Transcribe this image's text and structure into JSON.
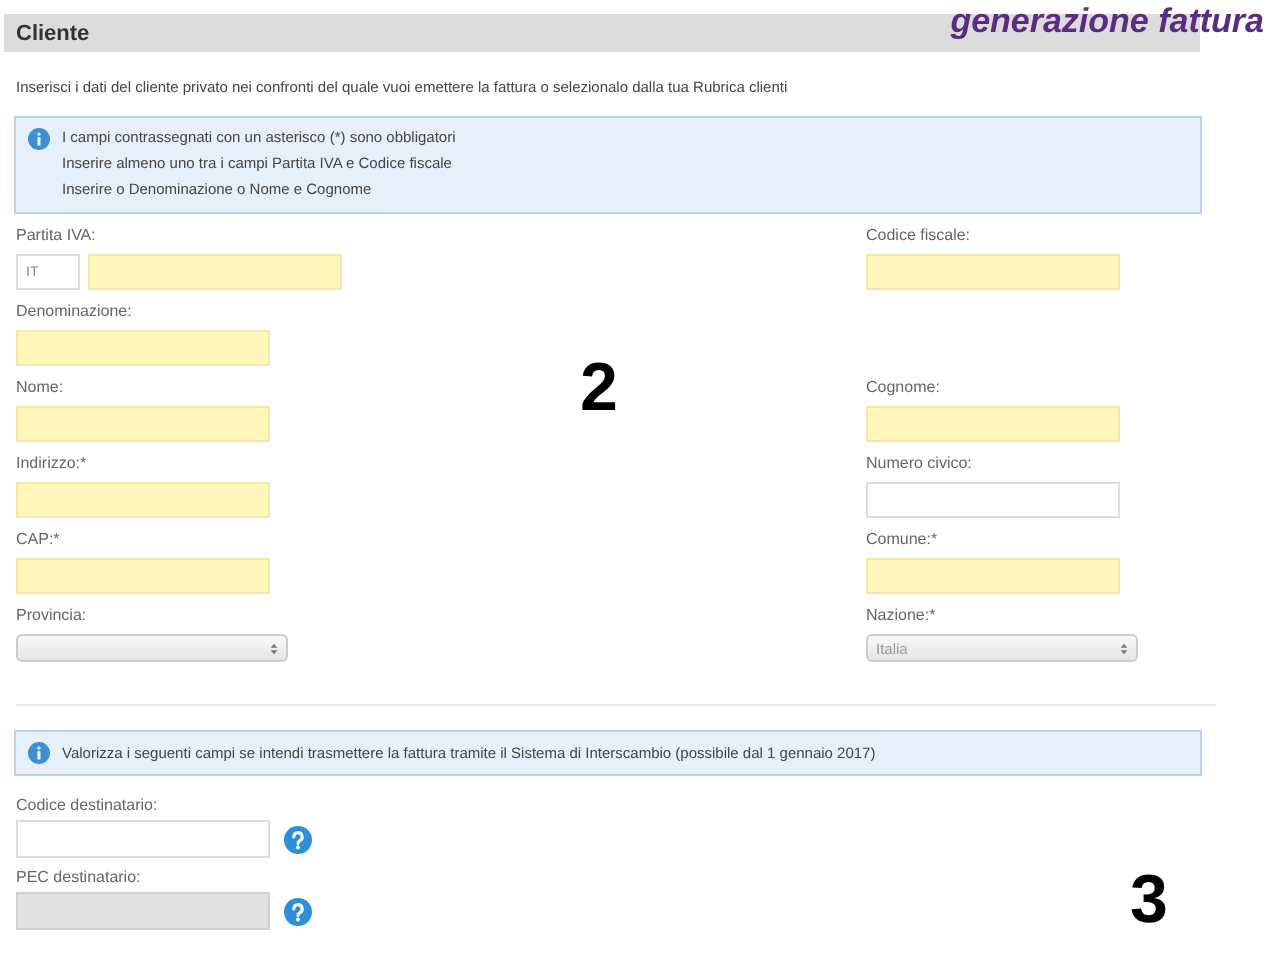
{
  "header": {
    "title": "Cliente"
  },
  "overlay_title": "generazione fattura",
  "intro": "Inserisci i dati del cliente privato nei confronti del quale vuoi emettere la fattura o selezionalo dalla tua Rubrica clienti",
  "info_box": {
    "lines": [
      "I campi contrassegnati con un asterisco (*) sono obbligatori",
      "Inserire almeno uno tra i campi Partita IVA e Codice fiscale",
      "Inserire o Denominazione o Nome e Cognome"
    ]
  },
  "rows": [
    {
      "left": {
        "label": "Partita IVA:",
        "kind": "vat",
        "prefix": "IT",
        "highlighted": true
      },
      "right": {
        "label": "Codice fiscale:",
        "kind": "input",
        "highlighted": true
      }
    },
    {
      "left": {
        "label": "Denominazione:",
        "kind": "input",
        "highlighted": true
      }
    },
    {
      "left": {
        "label": "Nome:",
        "kind": "input",
        "highlighted": true
      },
      "right": {
        "label": "Cognome:",
        "kind": "input",
        "highlighted": true
      }
    },
    {
      "left": {
        "label": "Indirizzo:*",
        "kind": "input",
        "highlighted": true
      },
      "right": {
        "label": "Numero civico:",
        "kind": "input",
        "highlighted": false
      }
    },
    {
      "left": {
        "label": "CAP:*",
        "kind": "input",
        "highlighted": true
      },
      "right": {
        "label": "Comune:*",
        "kind": "input",
        "highlighted": true
      }
    },
    {
      "left": {
        "label": "Provincia:",
        "kind": "select"
      },
      "right": {
        "label": "Nazione:*",
        "kind": "select",
        "value": "Italia"
      }
    }
  ],
  "sdi_info": "Valorizza i seguenti campi se intendi trasmettere la fattura tramite il Sistema di Interscambio (possibile dal 1 gennaio 2017)",
  "sdi_fields": [
    {
      "label": "Codice destinatario:",
      "disabled": false
    },
    {
      "label": "PEC destinatario:",
      "disabled": true
    }
  ],
  "annotations": [
    "2",
    "3"
  ]
}
